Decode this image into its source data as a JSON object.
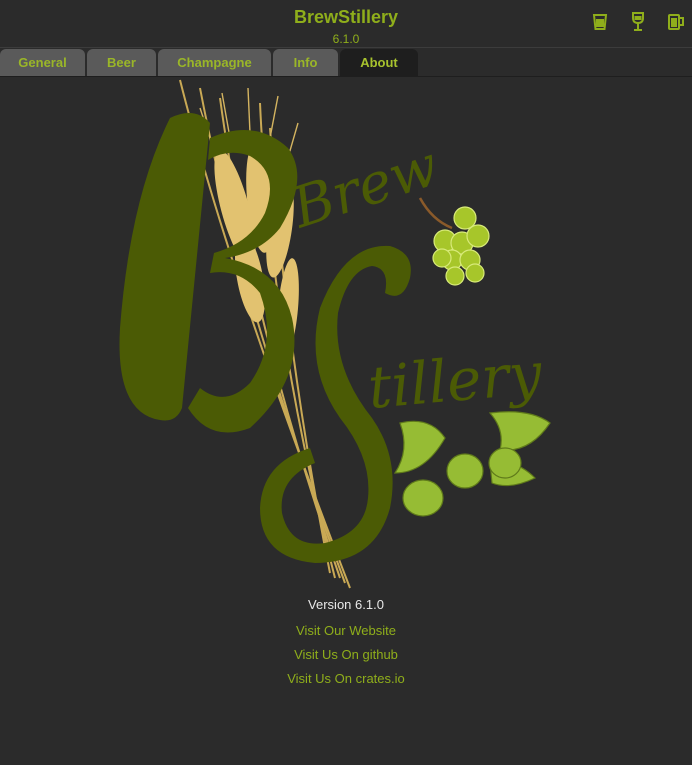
{
  "app": {
    "title": "BrewStillery",
    "version": "6.1.0"
  },
  "header_icons": [
    "beer-glass-icon",
    "wine-glass-icon",
    "beer-mug-icon"
  ],
  "tabs": [
    {
      "label": "General",
      "active": false
    },
    {
      "label": "Beer",
      "active": false
    },
    {
      "label": "Champagne",
      "active": false
    },
    {
      "label": "Info",
      "active": false
    },
    {
      "label": "About",
      "active": true
    }
  ],
  "logo": {
    "text_top": "Brew",
    "text_bottom": "Stillery",
    "initials": "BS"
  },
  "about": {
    "version_text": "Version 6.1.0",
    "links": [
      "Visit Our Website",
      "Visit Us On github",
      "Visit Us On crates.io"
    ]
  },
  "colors": {
    "accent": "#8fae1b",
    "logo_green": "#4c5c06",
    "background": "#2b2b2b"
  }
}
